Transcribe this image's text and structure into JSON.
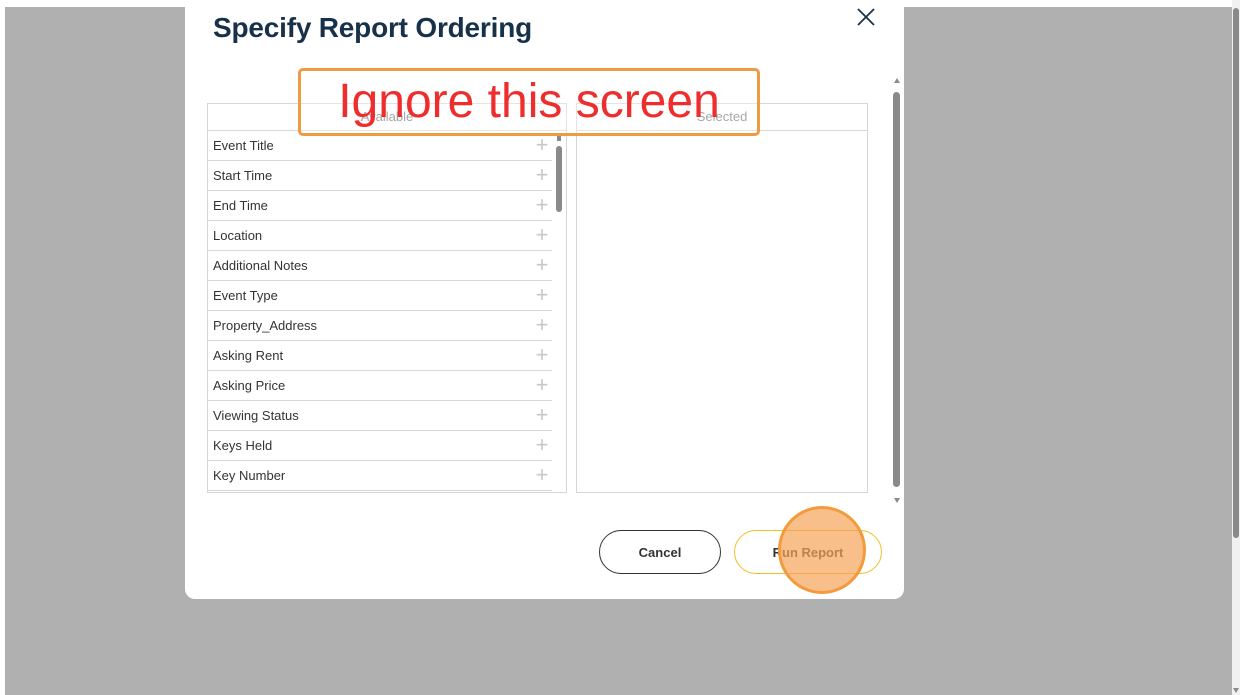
{
  "dialog": {
    "title": "Specify Report Ordering",
    "available_header": "Available",
    "selected_header": "Selected",
    "available_fields": [
      "Event Title",
      "Start Time",
      "End Time",
      "Location",
      "Additional Notes",
      "Event Type",
      "Property_Address",
      "Asking Rent",
      "Asking Price",
      "Viewing Status",
      "Keys Held",
      "Key Number"
    ],
    "selected_fields": [],
    "cancel_label": "Cancel",
    "run_label": "Run Report"
  },
  "annotation": {
    "text": "Ignore this screen"
  },
  "icons": {
    "close": "close-icon",
    "add": "plus-icon"
  },
  "colors": {
    "title": "#17314a",
    "run_border": "#f0c020",
    "marker": "#f39a3c",
    "annotation_text": "#ef2d2d",
    "annotation_border": "#ef9a45"
  }
}
